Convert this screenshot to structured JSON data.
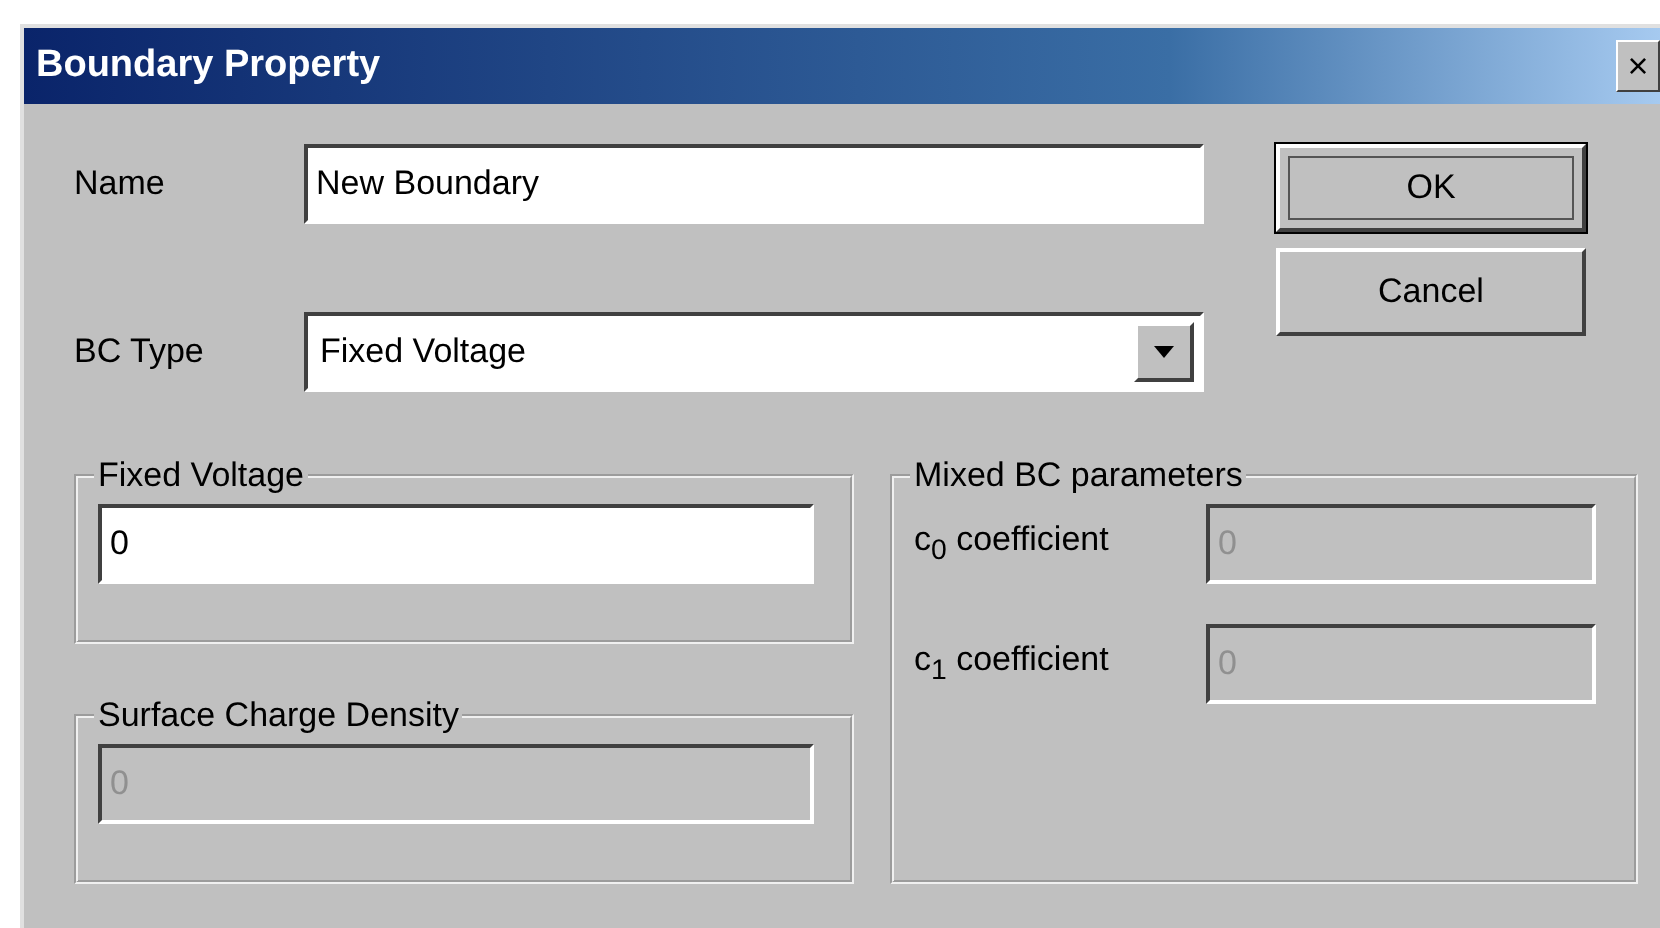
{
  "window": {
    "title": "Boundary Property",
    "close": "×"
  },
  "name": {
    "label": "Name",
    "value": "New Boundary"
  },
  "bc_type": {
    "label": "BC Type",
    "value": "Fixed Voltage"
  },
  "buttons": [
    {
      "label": "OK",
      "default": true
    },
    {
      "label": "Cancel",
      "default": false
    }
  ],
  "fixed_voltage": {
    "title": "Fixed Voltage",
    "value": "0",
    "disabled": false
  },
  "surface_charge_density": {
    "title": "Surface Charge Density",
    "value": "0",
    "disabled": true
  },
  "mixed_bc": {
    "title": "Mixed BC parameters",
    "fields": [
      {
        "label": "c$_{0}$ coefficient",
        "value": "0",
        "disabled": true
      },
      {
        "label": "c$_{1}$ coefficient",
        "value": "0",
        "disabled": true
      }
    ]
  }
}
